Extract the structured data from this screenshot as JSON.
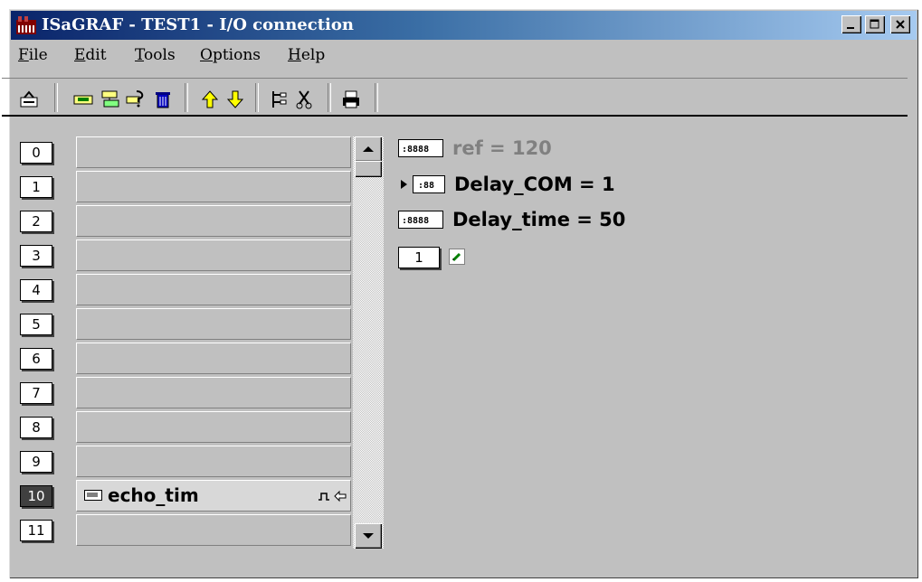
{
  "window": {
    "title": "ISaGRAF - TEST1 - I/O connection",
    "controls": [
      "minimize",
      "maximize",
      "close"
    ]
  },
  "menu": [
    {
      "label": "File",
      "accel": "F",
      "rest": "ile"
    },
    {
      "label": "Edit",
      "accel": "E",
      "rest": "dit"
    },
    {
      "label": "Tools",
      "accel": "T",
      "rest": "ools"
    },
    {
      "label": "Options",
      "accel": "O",
      "rest": "ptions"
    },
    {
      "label": "Help",
      "accel": "H",
      "rest": "elp"
    }
  ],
  "toolbar": {
    "icons": [
      "open-icon",
      "board-icon",
      "board-connect-icon",
      "board-param-icon",
      "delete-icon",
      "move-up-icon",
      "move-down-icon",
      "hierarchy-icon",
      "cut-icon",
      "print-icon"
    ]
  },
  "slots": [
    {
      "num": "0",
      "board": ""
    },
    {
      "num": "1",
      "board": ""
    },
    {
      "num": "2",
      "board": ""
    },
    {
      "num": "3",
      "board": ""
    },
    {
      "num": "4",
      "board": ""
    },
    {
      "num": "5",
      "board": ""
    },
    {
      "num": "6",
      "board": ""
    },
    {
      "num": "7",
      "board": ""
    },
    {
      "num": "8",
      "board": ""
    },
    {
      "num": "9",
      "board": ""
    },
    {
      "num": "10",
      "board": "echo_tim",
      "selected": true
    },
    {
      "num": "11",
      "board": ""
    }
  ],
  "params": [
    {
      "text": "ref = 120",
      "dim": true
    },
    {
      "text": "Delay_COM = 1",
      "dim": false,
      "expand": true
    },
    {
      "text": "Delay_time = 50",
      "dim": false
    }
  ],
  "channel": {
    "num": "1"
  },
  "colors": {
    "face": "#c0c0c0",
    "title_start": "#0a246a",
    "title_end": "#a6caf0",
    "selected_slot": "#404040"
  }
}
